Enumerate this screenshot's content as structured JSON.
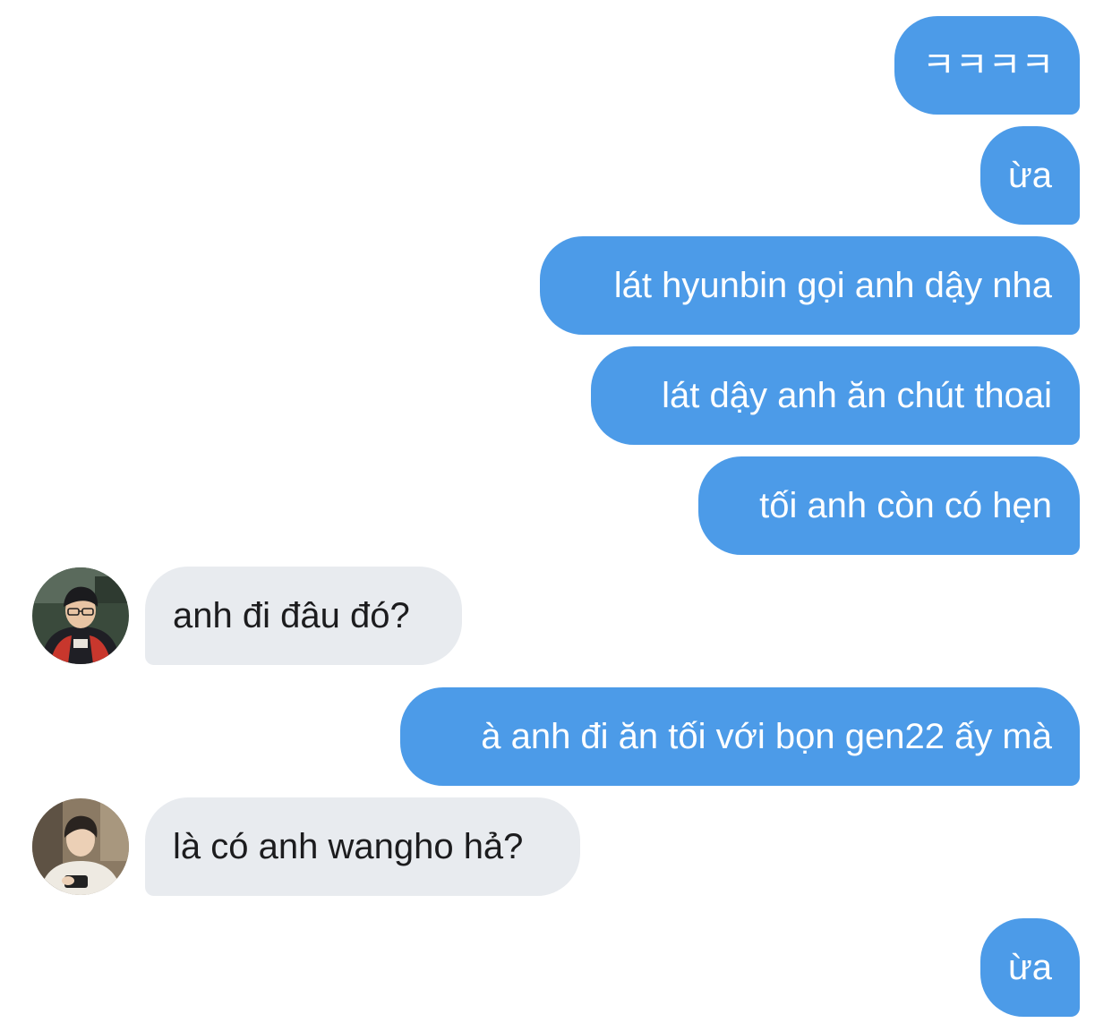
{
  "conversation": {
    "messages": [
      {
        "side": "sent",
        "text": "ㅋㅋㅋㅋ"
      },
      {
        "side": "sent",
        "text": "ừa"
      },
      {
        "side": "sent",
        "text": "lát hyunbin gọi anh dậy nha"
      },
      {
        "side": "sent",
        "text": "lát dậy anh ăn chút thoai"
      },
      {
        "side": "sent",
        "text": "tối anh còn có hẹn"
      },
      {
        "side": "received",
        "text": "anh đi đâu đó?"
      },
      {
        "side": "sent",
        "text": "à anh đi ăn tối với bọn gen22 ấy mà"
      },
      {
        "side": "received",
        "text": "là có anh wangho hả?"
      },
      {
        "side": "sent",
        "text": "ừa"
      }
    ]
  },
  "colors": {
    "sent_bubble": "#4c9be8",
    "received_bubble": "#e8ebef",
    "sent_text": "#ffffff",
    "received_text": "#1c1c1e",
    "background": "#ffffff"
  },
  "icons": {
    "avatar_1": "contact-avatar-photo",
    "avatar_2": "contact-avatar-photo"
  }
}
